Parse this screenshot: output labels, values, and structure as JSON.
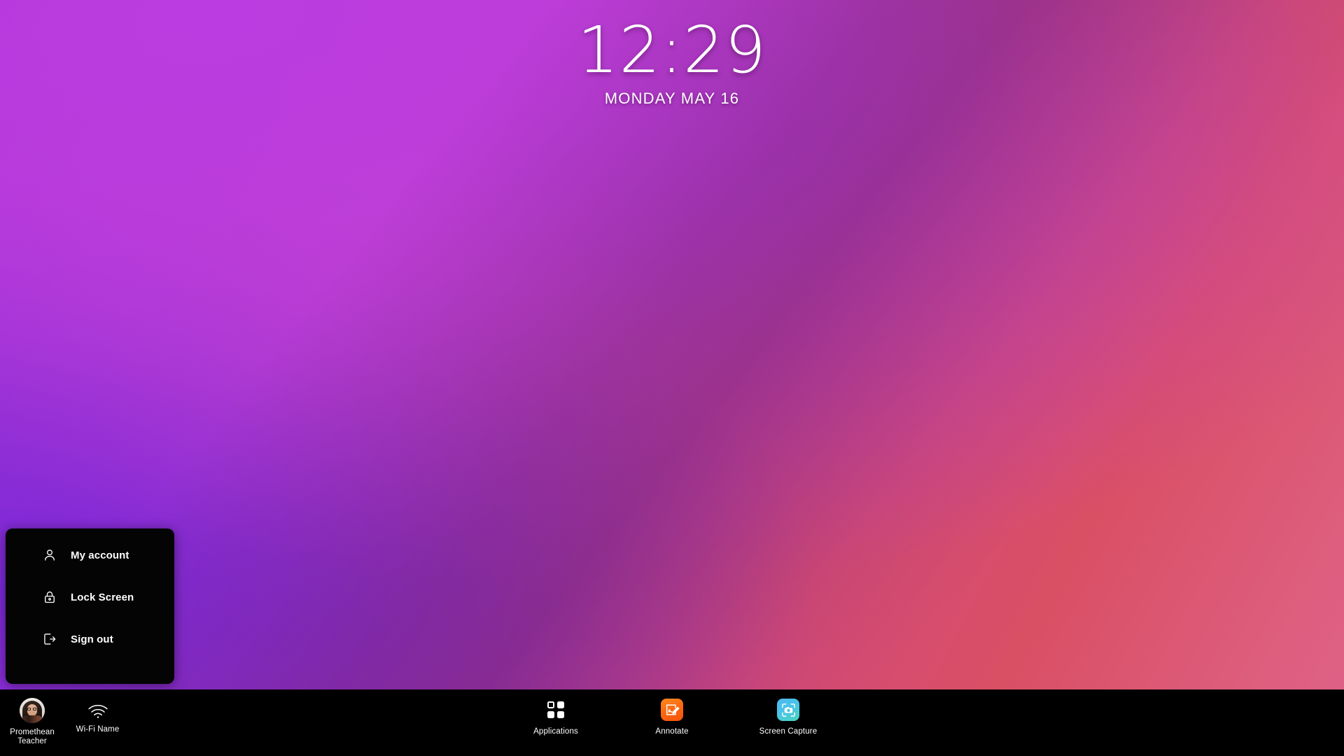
{
  "wallpaper": {
    "accent_purple": "#a932dd",
    "accent_magenta": "#c13fd2",
    "accent_pink": "#d9506b",
    "accent_violet": "#7a27d6"
  },
  "clock": {
    "time": "12:29",
    "date": "MONDAY MAY 16"
  },
  "context_menu": {
    "items": [
      {
        "label": "My account",
        "icon": "person-icon"
      },
      {
        "label": "Lock Screen",
        "icon": "lock-icon"
      },
      {
        "label": "Sign out",
        "icon": "sign-out-icon"
      }
    ]
  },
  "taskbar": {
    "user": {
      "name_line1": "Promethean",
      "name_line2": "Teacher",
      "avatar_icon": "user-avatar"
    },
    "network": {
      "label": "Wi-Fi Name",
      "icon": "wifi-icon"
    },
    "apps": [
      {
        "label": "Applications",
        "icon": "grid-icon"
      },
      {
        "label": "Annotate",
        "icon": "annotate-icon"
      },
      {
        "label": "Screen Capture",
        "icon": "screen-capture-icon"
      }
    ]
  }
}
